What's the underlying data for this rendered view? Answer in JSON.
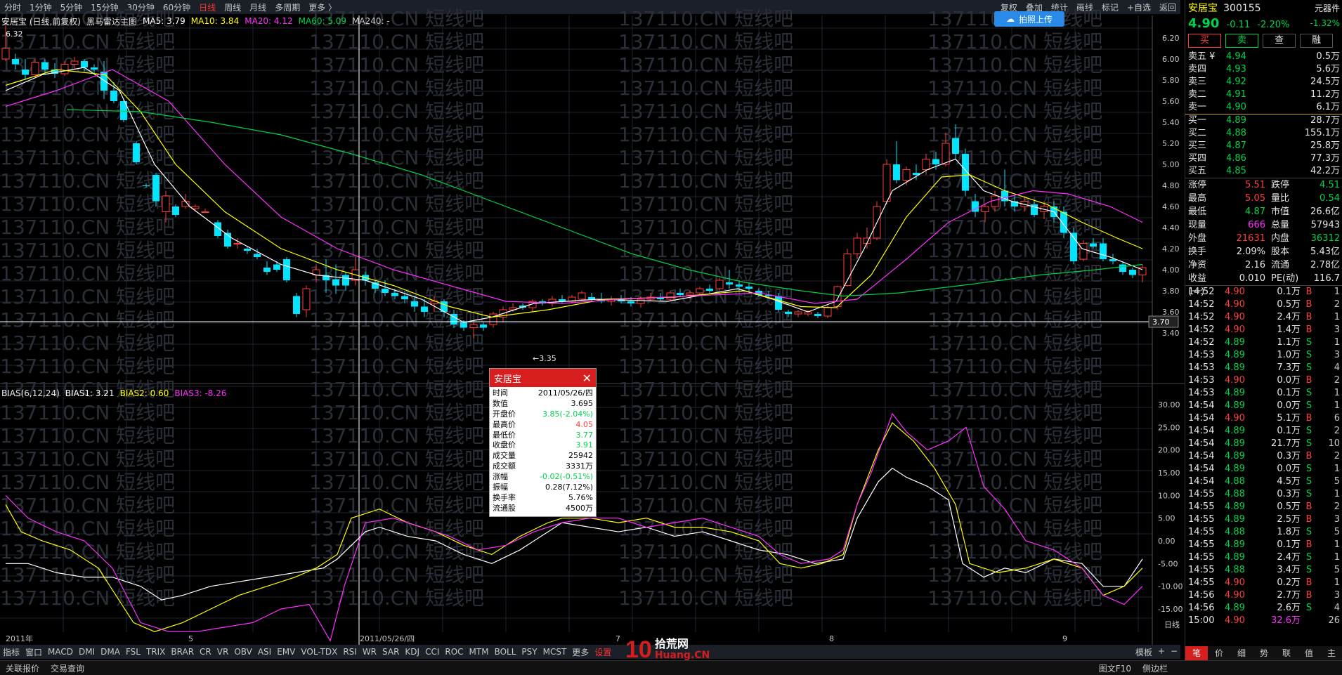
{
  "toolbar": {
    "periods": [
      "分时",
      "1分钟",
      "5分钟",
      "15分钟",
      "30分钟",
      "60分钟",
      "日线",
      "周线",
      "月线",
      "多周期",
      "更多 〉"
    ],
    "active": "日线",
    "right_items": [
      "复权",
      "叠加",
      "统计",
      "画线",
      "标记",
      "+自选",
      "返回"
    ]
  },
  "legend1": {
    "stock": "安居宝 (日线,前复权)",
    "indicator": "黑马雷达主图",
    "ma5": "MA5: 3.79",
    "ma10": "MA10: 3.84",
    "ma20": "MA20: 4.12",
    "ma60": "MA60: 5.09",
    "ma240": "MA240: -"
  },
  "legend2": {
    "name": "BIAS(6,12,24)",
    "bias1": "BIAS1: 3.21",
    "bias2": "BIAS2: 0.60",
    "bias3": "BIAS3: -8.26"
  },
  "upload_btn": "拍照上传",
  "price_high_label": "6.32",
  "price_low_label": "←3.35",
  "crosshair_price": "3.70",
  "price_axis": [
    "6.20",
    "6.00",
    "5.80",
    "5.60",
    "5.40",
    "5.20",
    "5.00",
    "4.80",
    "4.60",
    "4.40",
    "4.20",
    "4.00",
    "3.80",
    "3.60",
    "3.40"
  ],
  "bias_axis": [
    "30.00",
    "25.00",
    "20.00",
    "15.00",
    "10.00",
    "5.00",
    "0.00",
    "-5.00",
    "-10.00",
    "-15.00"
  ],
  "x_labels": [
    "2011年",
    "5",
    "2011/05/26/四",
    "7",
    "8",
    "9"
  ],
  "tooltip": {
    "title": "安居宝",
    "rows": [
      {
        "k": "时间",
        "v": "2011/05/26/四",
        "c": "black"
      },
      {
        "k": "数值",
        "v": "3.695",
        "c": "black"
      },
      {
        "k": "开盘价",
        "v": "3.85(-2.04%)",
        "c": "green"
      },
      {
        "k": "最高价",
        "v": "4.05",
        "c": "red"
      },
      {
        "k": "最低价",
        "v": "3.77",
        "c": "green"
      },
      {
        "k": "收盘价",
        "v": "3.91",
        "c": "green"
      },
      {
        "k": "成交量",
        "v": "25942",
        "c": "black"
      },
      {
        "k": "成交额",
        "v": "3331万",
        "c": "black"
      },
      {
        "k": "涨幅",
        "v": "-0.02(-0.51%)",
        "c": "green"
      },
      {
        "k": "振幅",
        "v": "0.28(7.12%)",
        "c": "black"
      },
      {
        "k": "换手率",
        "v": "5.76%",
        "c": "black"
      },
      {
        "k": "流通股",
        "v": "4500万",
        "c": "black"
      }
    ]
  },
  "bottom_tabs": [
    "指标",
    "窗口",
    "MACD",
    "DMI",
    "DMA",
    "FSL",
    "TRIX",
    "BRAR",
    "CR",
    "VR",
    "OBV",
    "ASI",
    "EMV",
    "VOL-TDX",
    "RSI",
    "WR",
    "SAR",
    "KDJ",
    "CCI",
    "ROC",
    "MTM",
    "BOLL",
    "PSY",
    "MCST",
    "更多",
    "设置"
  ],
  "bottom_right": [
    "模板",
    "+",
    "−"
  ],
  "status": [
    "关联报价",
    "交易查询"
  ],
  "status_right": [
    "图文F10",
    "侧边栏"
  ],
  "logo": {
    "num": "10",
    "title": "拾荒网",
    "site": "Huang.CN"
  },
  "watermark": "137110.CN 短线吧",
  "right": {
    "name": "安居宝",
    "code": "300155",
    "badge": "元器件",
    "price": "4.90",
    "change": "-0.11",
    "pct": "-2.20%",
    "sector_pct": "-1.32%",
    "buttons": [
      "买",
      "卖",
      "查",
      "融"
    ],
    "asks": [
      {
        "k": "卖五 ¥",
        "p": "4.94",
        "v": "0.5万"
      },
      {
        "k": "卖四",
        "p": "4.93",
        "v": "5.6万"
      },
      {
        "k": "卖三",
        "p": "4.92",
        "v": "24.5万"
      },
      {
        "k": "卖二",
        "p": "4.91",
        "v": "11.2万"
      },
      {
        "k": "卖一",
        "p": "4.90",
        "v": "6.1万"
      }
    ],
    "bids": [
      {
        "k": "买一",
        "p": "4.89",
        "v": "28.7万"
      },
      {
        "k": "买二",
        "p": "4.88",
        "v": "155.1万"
      },
      {
        "k": "买三",
        "p": "4.87",
        "v": "25.8万"
      },
      {
        "k": "买四",
        "p": "4.86",
        "v": "77.3万"
      },
      {
        "k": "买五",
        "p": "4.85",
        "v": "42.2万"
      }
    ],
    "stats": [
      {
        "k": "涨停",
        "v": "5.51",
        "vc": "red",
        "k2": "跌停",
        "v2": "4.51",
        "v2c": "green"
      },
      {
        "k": "最高",
        "v": "5.05",
        "vc": "red",
        "k2": "量比",
        "v2": "0.54",
        "v2c": "green"
      },
      {
        "k": "最低",
        "v": "4.87",
        "vc": "green",
        "k2": "市值",
        "v2": "26.6亿",
        "v2c": "white"
      },
      {
        "k": "现量",
        "v": "666",
        "vc": "magenta",
        "k2": "总量",
        "v2": "57943",
        "v2c": "white"
      },
      {
        "k": "外盘",
        "v": "21631",
        "vc": "red",
        "k2": "内盘",
        "v2": "36312",
        "v2c": "green"
      },
      {
        "k": "换手",
        "v": "2.09%",
        "vc": "white",
        "k2": "股本",
        "v2": "5.43亿",
        "v2c": "white"
      },
      {
        "k": "净资",
        "v": "2.16",
        "vc": "white",
        "k2": "流通",
        "v2": "2.78亿",
        "v2c": "white"
      },
      {
        "k": "收益(一)",
        "v": "0.010",
        "vc": "white",
        "k2": "PE(动)",
        "v2": "116.7",
        "v2c": "white"
      }
    ],
    "ticks": [
      {
        "t": "14:52",
        "p": "4.90",
        "pc": "red",
        "v": "0.1万",
        "d": "B",
        "n": "1"
      },
      {
        "t": "14:52",
        "p": "4.90",
        "pc": "red",
        "v": "0.5万",
        "d": "B",
        "n": "2"
      },
      {
        "t": "14:52",
        "p": "4.90",
        "pc": "red",
        "v": "2.4万",
        "d": "B",
        "n": "1"
      },
      {
        "t": "14:52",
        "p": "4.90",
        "pc": "red",
        "v": "1.4万",
        "d": "B",
        "n": "3"
      },
      {
        "t": "14:52",
        "p": "4.89",
        "pc": "green",
        "v": "1.1万",
        "d": "S",
        "n": "1"
      },
      {
        "t": "14:53",
        "p": "4.89",
        "pc": "green",
        "v": "1.0万",
        "d": "S",
        "n": "3"
      },
      {
        "t": "14:53",
        "p": "4.89",
        "pc": "green",
        "v": "7.3万",
        "d": "S",
        "n": "4"
      },
      {
        "t": "14:53",
        "p": "4.90",
        "pc": "red",
        "v": "0.0万",
        "d": "B",
        "n": "2"
      },
      {
        "t": "14:53",
        "p": "4.89",
        "pc": "green",
        "v": "0.1万",
        "d": "S",
        "n": "1"
      },
      {
        "t": "14:54",
        "p": "4.89",
        "pc": "green",
        "v": "0.0万",
        "d": "S",
        "n": "1"
      },
      {
        "t": "14:54",
        "p": "4.90",
        "pc": "red",
        "v": "5.1万",
        "d": "B",
        "n": "6"
      },
      {
        "t": "14:54",
        "p": "4.89",
        "pc": "green",
        "v": "0.1万",
        "d": "S",
        "n": "2"
      },
      {
        "t": "14:54",
        "p": "4.89",
        "pc": "green",
        "v": "21.7万",
        "d": "S",
        "n": "10"
      },
      {
        "t": "14:54",
        "p": "4.89",
        "pc": "green",
        "v": "0.3万",
        "d": "B",
        "n": "2"
      },
      {
        "t": "14:54",
        "p": "4.89",
        "pc": "green",
        "v": "0.0万",
        "d": "S",
        "n": "1"
      },
      {
        "t": "14:54",
        "p": "4.88",
        "pc": "green",
        "v": "4.5万",
        "d": "S",
        "n": "5"
      },
      {
        "t": "14:55",
        "p": "4.88",
        "pc": "green",
        "v": "0.3万",
        "d": "S",
        "n": "1"
      },
      {
        "t": "14:55",
        "p": "4.89",
        "pc": "green",
        "v": "0.5万",
        "d": "B",
        "n": "2"
      },
      {
        "t": "14:55",
        "p": "4.89",
        "pc": "green",
        "v": "2.5万",
        "d": "B",
        "n": "3"
      },
      {
        "t": "14:55",
        "p": "4.88",
        "pc": "green",
        "v": "1.8万",
        "d": "S",
        "n": "5"
      },
      {
        "t": "14:55",
        "p": "4.89",
        "pc": "green",
        "v": "0.1万",
        "d": "B",
        "n": "1"
      },
      {
        "t": "14:55",
        "p": "4.89",
        "pc": "green",
        "v": "2.4万",
        "d": "S",
        "n": "1"
      },
      {
        "t": "14:55",
        "p": "4.88",
        "pc": "green",
        "v": "3.4万",
        "d": "S",
        "n": "5"
      },
      {
        "t": "14:55",
        "p": "4.90",
        "pc": "red",
        "v": "0.2万",
        "d": "B",
        "n": "1"
      },
      {
        "t": "14:56",
        "p": "4.90",
        "pc": "red",
        "v": "2.7万",
        "d": "B",
        "n": "3"
      },
      {
        "t": "14:56",
        "p": "4.89",
        "pc": "green",
        "v": "2.6万",
        "d": "S",
        "n": "4"
      },
      {
        "t": "15:00",
        "p": "4.90",
        "pc": "red",
        "v": "32.6万",
        "d": "",
        "n": "26"
      }
    ],
    "tabs": [
      "笔",
      "价",
      "细",
      "势",
      "联",
      "值",
      "主"
    ]
  }
}
